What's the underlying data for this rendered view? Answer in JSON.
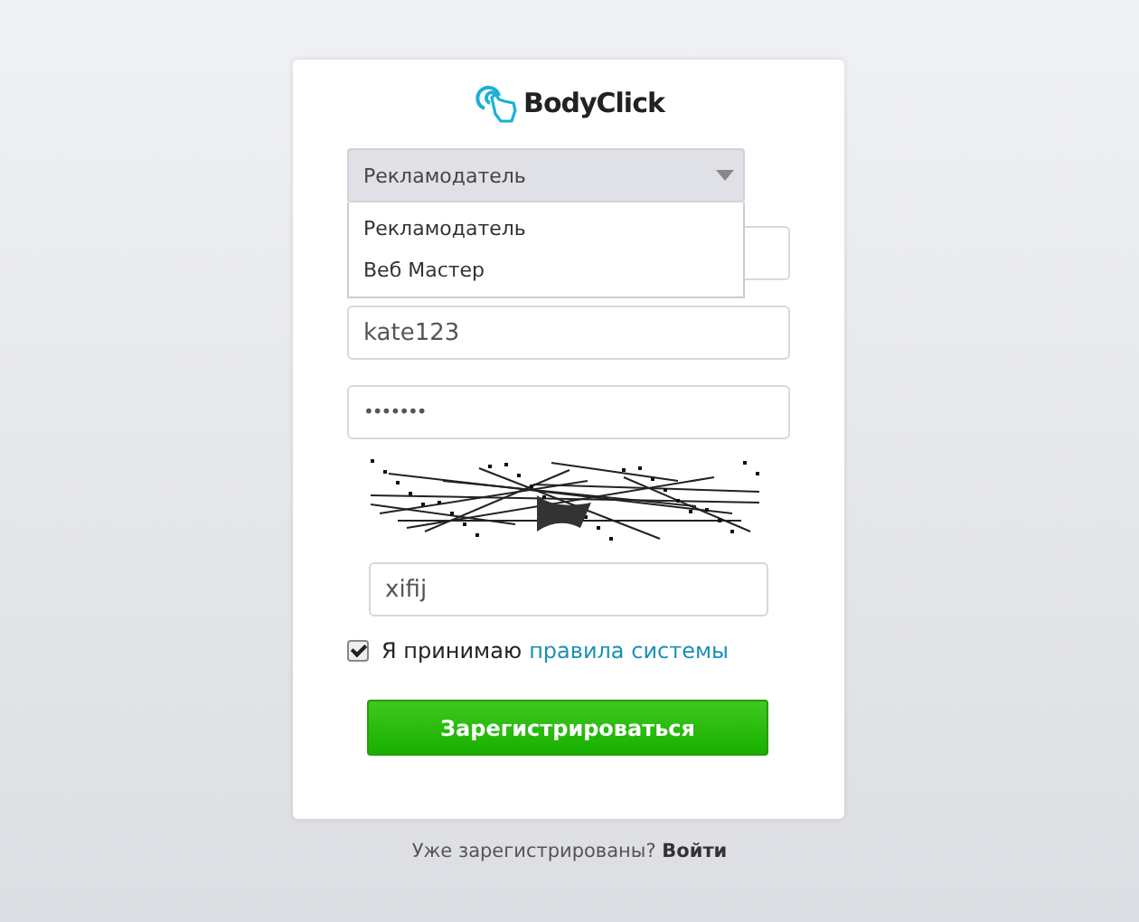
{
  "logo": {
    "text": "BodyClick"
  },
  "role_select": {
    "value": "Рекламодатель",
    "expanded": true,
    "options": [
      {
        "label": "Рекламодатель"
      },
      {
        "label": "Веб Мастер"
      }
    ]
  },
  "fields": [
    {
      "kind": "text"
    },
    {
      "kind": "text",
      "value": "kate123"
    },
    {
      "kind": "password",
      "value": "•••••••"
    }
  ],
  "captcha_field": {
    "value": "xifij"
  },
  "agreement": {
    "checked": true,
    "text": "Я принимаю",
    "link": "правила системы"
  },
  "submit": {
    "label": "Зарегистрироваться"
  },
  "footer": {
    "text": "Уже зарегистрированы?",
    "link": "Войти"
  }
}
